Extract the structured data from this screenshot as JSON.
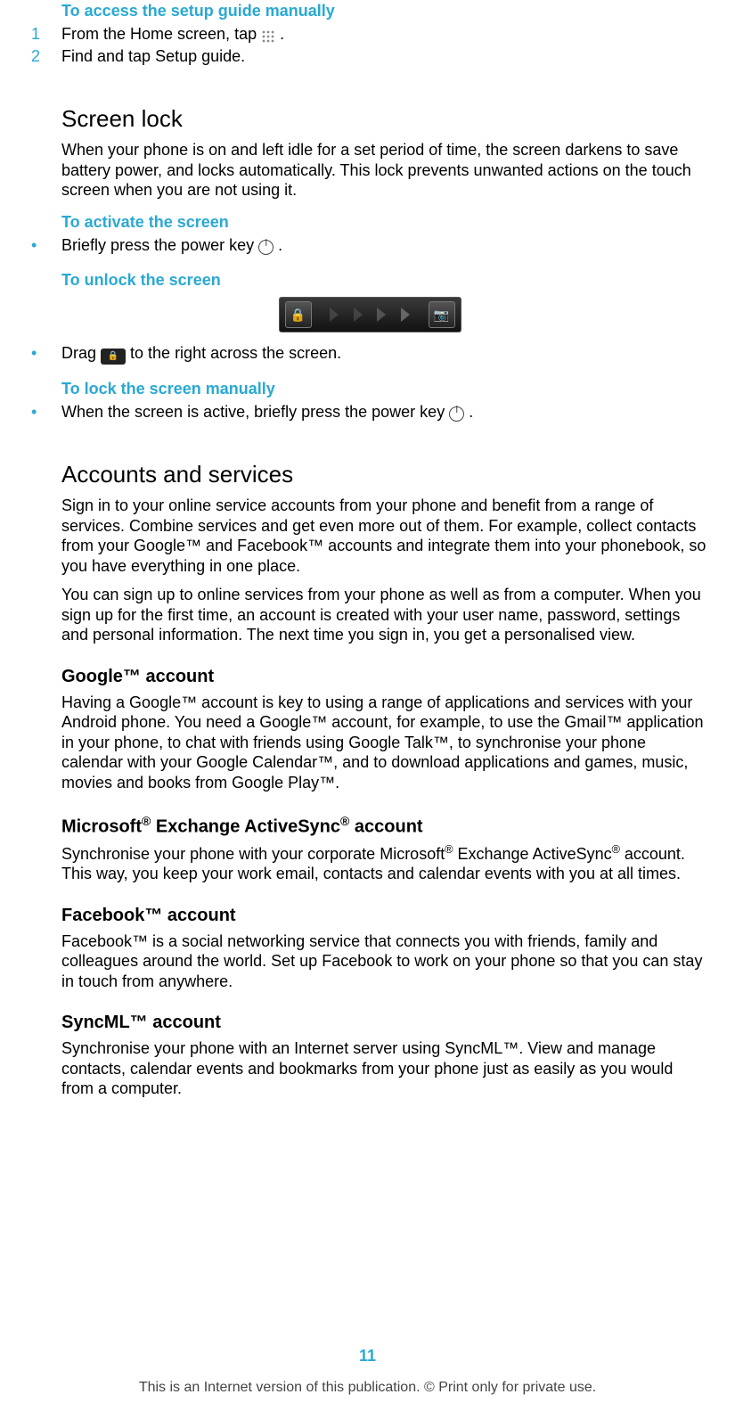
{
  "access_guide": {
    "title": "To access the setup guide manually",
    "steps": [
      {
        "num": "1",
        "before": "From the Home screen, tap ",
        "after": "."
      },
      {
        "num": "2",
        "text": "Find and tap Setup guide."
      }
    ]
  },
  "screen_lock": {
    "heading": "Screen lock",
    "intro": "When your phone is on and left idle for a set period of time, the screen darkens to save battery power, and locks automatically. This lock prevents unwanted actions on the touch screen when you are not using it.",
    "activate_title": "To activate the screen",
    "activate_before": "Briefly press the power key ",
    "activate_after": ".",
    "unlock_title": "To unlock the screen",
    "drag_before": "Drag ",
    "drag_after": " to the right across the screen.",
    "lock_title": "To lock the screen manually",
    "lock_before": "When the screen is active, briefly press the power key ",
    "lock_after": "."
  },
  "accounts": {
    "heading": "Accounts and services",
    "p1": "Sign in to your online service accounts from your phone and benefit from a range of services. Combine services and get even more out of them. For example, collect contacts from your Google™ and Facebook™ accounts and integrate them into your phonebook, so you have everything in one place.",
    "p2": "You can sign up to online services from your phone as well as from a computer. When you sign up for the first time, an account is created with your user name, password, settings and personal information. The next time you sign in, you get a personalised view."
  },
  "google": {
    "heading": "Google™ account",
    "text": "Having a Google™ account is key to using a range of applications and services with your Android phone. You need a Google™ account, for example, to use the Gmail™ application in your phone, to chat with friends using Google Talk™, to synchronise your phone calendar with your Google Calendar™, and to download applications and games, music, movies and books from Google Play™."
  },
  "exchange": {
    "heading_before": "Microsoft",
    "heading_mid": " Exchange ActiveSync",
    "heading_after": " account",
    "text_before": "Synchronise your phone with your corporate Microsoft",
    "text_mid": " Exchange ActiveSync",
    "text_after": " account. This way, you keep your work email, contacts and calendar events with you at all times."
  },
  "facebook": {
    "heading": "Facebook™ account",
    "text": "Facebook™ is a social networking service that connects you with friends, family and colleagues around the world. Set up Facebook to work on your phone so that you can stay in touch from anywhere."
  },
  "syncml": {
    "heading": "SyncML™ account",
    "text": "Synchronise your phone with an Internet server using SyncML™. View and manage contacts, calendar events and bookmarks from your phone just as easily as you would from a computer."
  },
  "footer": {
    "page": "11",
    "line": "This is an Internet version of this publication. © Print only for private use."
  }
}
